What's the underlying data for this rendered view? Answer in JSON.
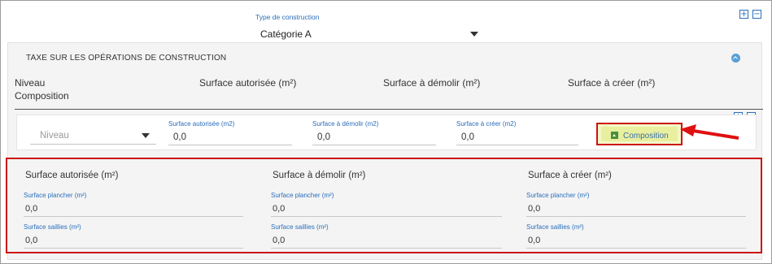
{
  "type_construction": {
    "label": "Type de construction",
    "value": "Catégorie A"
  },
  "controls": {
    "add": "+",
    "remove": "−"
  },
  "section": {
    "title": "TAXE SUR LES OPÉRATIONS DE CONSTRUCTION",
    "headers": {
      "niveau": "Niveau",
      "composition": "Composition",
      "surface_autorisee": "Surface autorisée (m²)",
      "surface_demolir": "Surface à démolir (m²)",
      "surface_creer": "Surface à créer (m²)"
    }
  },
  "row": {
    "niveau_placeholder": "Niveau",
    "surface_autorisee": {
      "label": "Surface autorisée (m2)",
      "value": "0,0"
    },
    "surface_demolir": {
      "label": "Surface à démolir (m2)",
      "value": "0,0"
    },
    "surface_creer": {
      "label": "Surface à créer (m2)",
      "value": "0,0"
    },
    "composition_button": "Composition"
  },
  "composition": {
    "groups": [
      {
        "title": "Surface autorisée (m²)",
        "plancher": {
          "label": "Surface plancher (m²)",
          "value": "0,0"
        },
        "saillies": {
          "label": "Surface saillies (m²)",
          "value": "0,0"
        }
      },
      {
        "title": "Surface à démolir (m²)",
        "plancher": {
          "label": "Surface plancher (m²)",
          "value": "0,0"
        },
        "saillies": {
          "label": "Surface saillies (m²)",
          "value": "0,0"
        }
      },
      {
        "title": "Surface à créer (m²)",
        "plancher": {
          "label": "Surface plancher (m²)",
          "value": "0,0"
        },
        "saillies": {
          "label": "Surface saillies (m²)",
          "value": "0,0"
        }
      }
    ]
  },
  "colors": {
    "accent": "#2a6ebb",
    "highlight": "#cc1111",
    "button_bg": "#e8ef9e"
  },
  "icons": {
    "add": "plus-square-icon",
    "remove": "minus-square-icon",
    "collapse": "chevron-up-circle-icon",
    "dropdown": "caret-down-icon",
    "composition": "expand-icon",
    "annotation": "red-arrow-icon"
  }
}
